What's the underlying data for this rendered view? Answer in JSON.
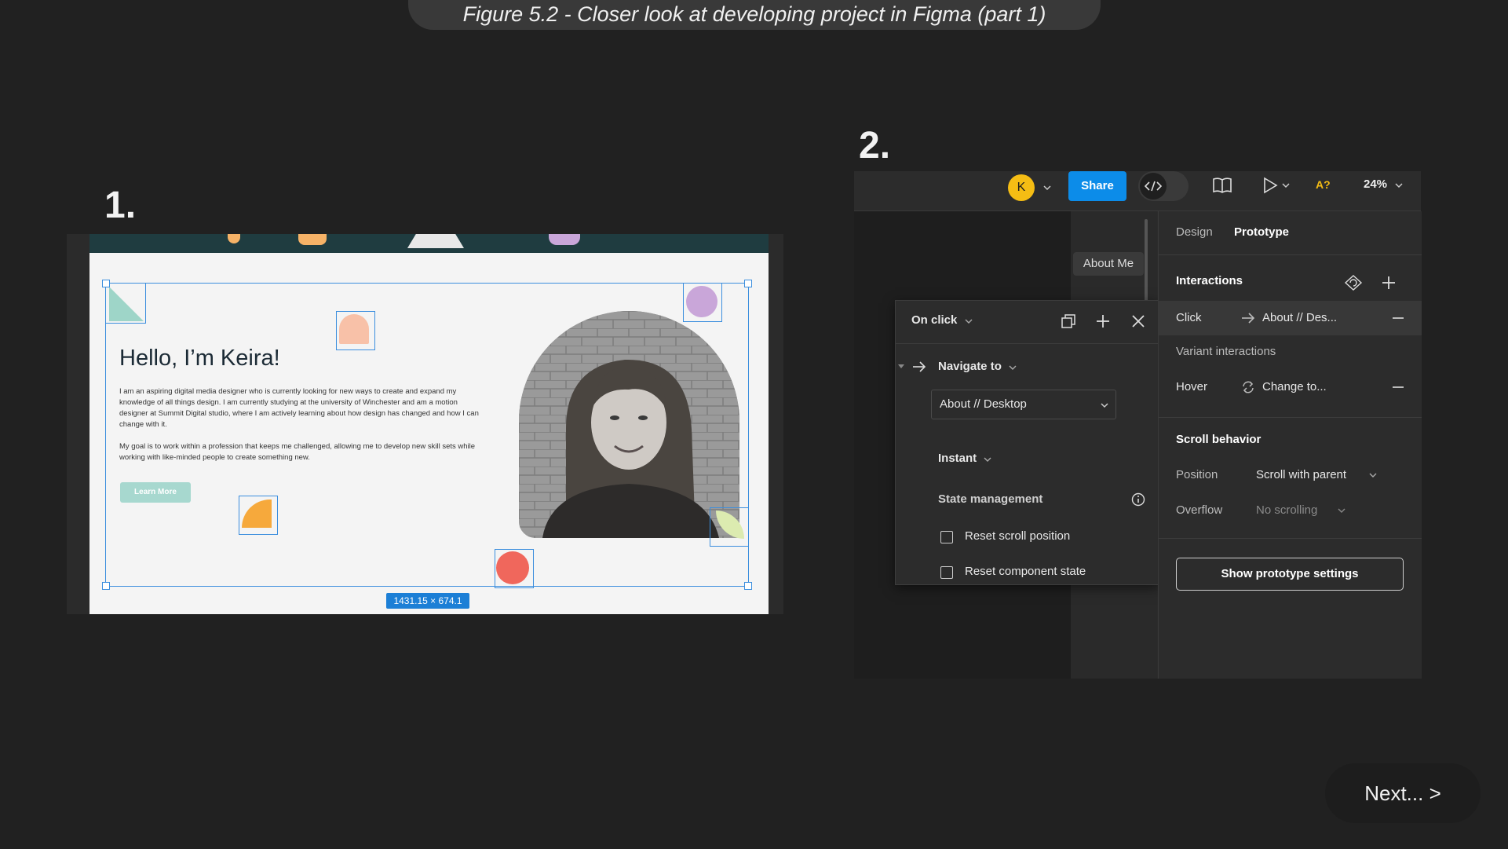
{
  "caption": "Figure 5.2 - Closer look at developing project in Figma (part 1)",
  "step1": "1.",
  "step2": "2.",
  "panel1": {
    "heading": "Hello, I’m Keira!",
    "paragraph1": "I am an aspiring digital media designer who is currently looking for new ways to create and expand my knowledge of all things design. I am currently studying at the university of Winchester and am a motion designer at Summit Digital studio, where I am actively learning about how design has changed and how I can change with it.",
    "paragraph2": "My goal is to work within a profession that keeps me challenged, allowing me to develop new skill sets while working with like-minded people to create something new.",
    "button": "Learn More",
    "dimensions": "1431.15 × 674.1"
  },
  "toolbar": {
    "avatar_letter": "K",
    "share": "Share",
    "zoom": "24%",
    "a_label": "A?"
  },
  "canvas": {
    "frame_label": "About Me"
  },
  "popup": {
    "trigger": "On click",
    "action": "Navigate to",
    "destination": "About // Desktop",
    "animation": "Instant",
    "state_title": "State management",
    "reset_scroll": "Reset scroll position",
    "reset_component": "Reset component state"
  },
  "right_panel": {
    "tabs": [
      "Design",
      "Prototype"
    ],
    "interactions_title": "Interactions",
    "click_label": "Click",
    "click_value": "About // Des...",
    "variant_title": "Variant interactions",
    "hover_label": "Hover",
    "hover_value": "Change to...",
    "scroll_title": "Scroll behavior",
    "position_label": "Position",
    "position_value": "Scroll with parent",
    "overflow_label": "Overflow",
    "overflow_value": "No scrolling",
    "settings_button": "Show prototype settings"
  },
  "next": "Next... >",
  "colors": {
    "share_blue": "#0c8ce9",
    "avatar_yellow": "#f5bd14",
    "selection_blue": "#3b8ede",
    "site_dark": "#1f3c40",
    "background": "#212121"
  }
}
